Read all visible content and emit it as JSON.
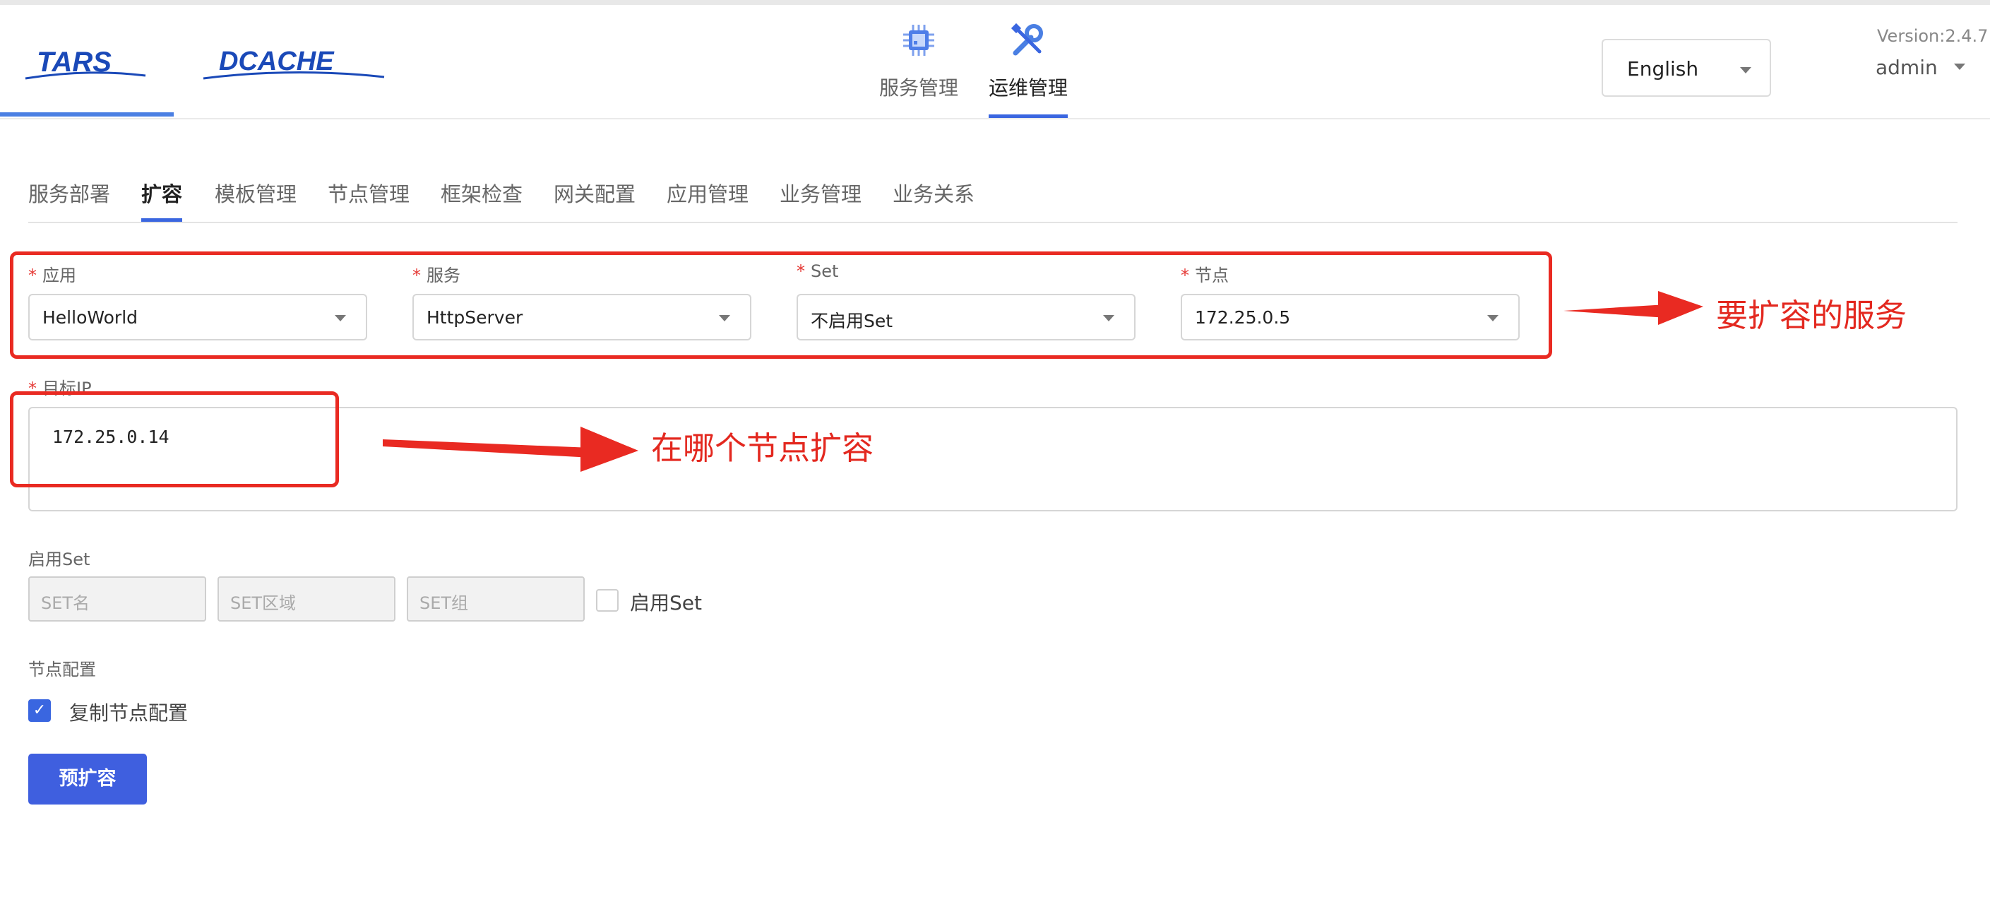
{
  "app": {
    "logos": [
      "TARS",
      "DCACHE"
    ],
    "version": "Version:2.4.7",
    "user": "admin",
    "language": "English"
  },
  "top_nav": [
    {
      "label": "服务管理",
      "icon": "chip-icon",
      "active": false
    },
    {
      "label": "运维管理",
      "icon": "wrench-screwdriver-icon",
      "active": true
    }
  ],
  "sub_tabs": [
    "服务部署",
    "扩容",
    "模板管理",
    "节点管理",
    "框架检查",
    "网关配置",
    "应用管理",
    "业务管理",
    "业务关系"
  ],
  "active_sub_tab": "扩容",
  "form": {
    "app": {
      "label": "应用",
      "value": "HelloWorld"
    },
    "server": {
      "label": "服务",
      "value": "HttpServer"
    },
    "set": {
      "label": "Set",
      "value": "不启用Set"
    },
    "node": {
      "label": "节点",
      "value": "172.25.0.5"
    },
    "target_ip": {
      "label": "目标IP",
      "value": "172.25.0.14"
    },
    "enable_set": {
      "label": "启用Set",
      "set_name_placeholder": "SET名",
      "set_area_placeholder": "SET区域",
      "set_group_placeholder": "SET组",
      "checkbox_label": "启用Set",
      "checked": false
    },
    "node_config": {
      "label": "节点配置",
      "checkbox_label": "复制节点配置",
      "checked": true
    },
    "submit_label": "预扩容"
  },
  "annotations": {
    "service_note": "要扩容的服务",
    "node_note": "在哪个节点扩容"
  },
  "colors": {
    "accent": "#3f5fdf",
    "annotation": "#e92a22",
    "required": "#e53935"
  }
}
